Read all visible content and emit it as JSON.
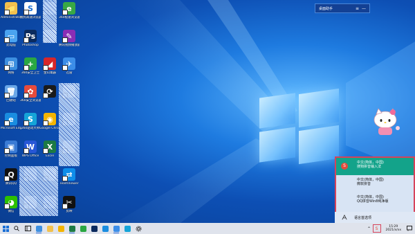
{
  "desktop": {
    "icons_col1": [
      {
        "label": "Administrator",
        "color": "#f2c14e",
        "glyph": "📁"
      },
      {
        "label": "此电脑",
        "color": "#4aa3f0",
        "glyph": "▭"
      },
      {
        "label": "网络",
        "color": "#3d8fe0",
        "glyph": "⊞"
      },
      {
        "label": "回收站",
        "color": "#6aa7e8",
        "glyph": "🗑"
      },
      {
        "label": "Microsoft Edge",
        "color": "#1a8de0",
        "glyph": "e"
      },
      {
        "label": "控制面板",
        "color": "#3a7bd5",
        "glyph": "▣"
      },
      {
        "label": "腾讯QQ",
        "color": "#111111",
        "glyph": "Q"
      },
      {
        "label": "微信",
        "color": "#2dc100",
        "glyph": "◕"
      }
    ],
    "icons_col2": [
      {
        "label": "搜狗高速浏览器",
        "color": "#ffffff",
        "glyph": "S"
      },
      {
        "label": "Photoshop",
        "color": "#0a2a5e",
        "glyph": "Ps"
      },
      {
        "label": "360安全卫士",
        "color": "#2aa742",
        "glyph": "+"
      },
      {
        "label": "360安全浏览器",
        "color": "#e64b3c",
        "glyph": "✿"
      },
      {
        "label": "360驱动大师",
        "color": "#15a4d8",
        "glyph": "S"
      },
      {
        "label": "WPS Office",
        "color": "#2757d6",
        "glyph": "W"
      },
      {
        "label": "",
        "color": "#ffffff",
        "glyph": ""
      },
      {
        "label": "",
        "color": "#ffffff",
        "glyph": ""
      }
    ],
    "icons_col3": [
      {
        "label": "",
        "color": "#ffffff",
        "glyph": ""
      },
      {
        "label": "",
        "color": "#ffffff",
        "glyph": ""
      },
      {
        "label": "金山毒霸",
        "color": "#d6262a",
        "glyph": "◢"
      },
      {
        "label": "",
        "color": "#1a1a1a",
        "glyph": "⟳"
      },
      {
        "label": "Google Chrome",
        "color": "#f4b400",
        "glyph": "◉"
      },
      {
        "label": "Excel",
        "color": "#1d7a44",
        "glyph": "X"
      },
      {
        "label": "",
        "color": "#ffffff",
        "glyph": ""
      },
      {
        "label": "",
        "color": "#ffffff",
        "glyph": ""
      }
    ],
    "icons_col4": [
      {
        "label": "360极速浏览器",
        "color": "#39a845",
        "glyph": "e"
      },
      {
        "label": "腾讯视频播放器",
        "color": "#8a2db5",
        "glyph": "✎"
      },
      {
        "label": "迅雷",
        "color": "#3b8de8",
        "glyph": "✈"
      },
      {
        "label": "",
        "color": "#ffffff",
        "glyph": ""
      },
      {
        "label": "",
        "color": "#ffffff",
        "glyph": ""
      },
      {
        "label": "",
        "color": "#ffffff",
        "glyph": ""
      },
      {
        "label": "TeamViewer",
        "color": "#0e8ee9",
        "glyph": "⇄"
      },
      {
        "label": "剪映",
        "color": "#111111",
        "glyph": "✂"
      }
    ]
  },
  "widget": {
    "title": "桌面助手",
    "ctrl1": "≡",
    "ctrl2": "—"
  },
  "ime_menu": {
    "items": [
      {
        "line1": "中文(简体，中国)",
        "line2": "搜狗拼音输入法",
        "selected": true
      },
      {
        "line1": "中文(简体，中国)",
        "line2": "微软拼音",
        "selected": false
      },
      {
        "line1": "中文(简体，中国)",
        "line2": "QQ拼音Win8纯净版",
        "selected": false
      }
    ],
    "preferences_label": "语言首选项"
  },
  "taskbar": {
    "start_icon": "start-icon",
    "clock_time": "15:29",
    "clock_date": "2021/x/xx",
    "ime_indicator": "S",
    "accent": "#2f6bd8"
  }
}
